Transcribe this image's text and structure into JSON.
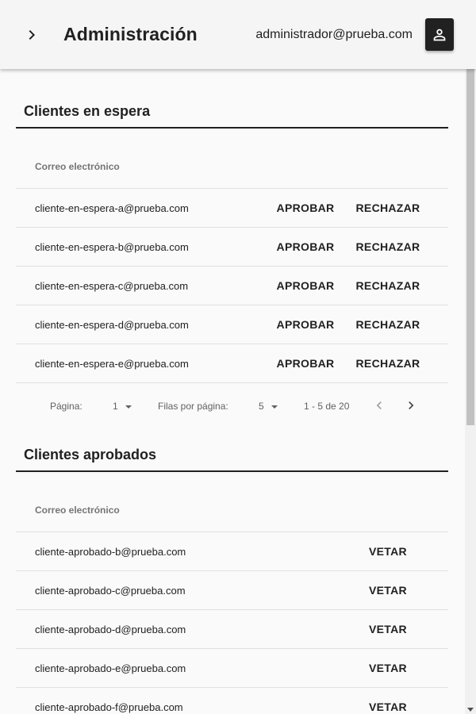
{
  "header": {
    "title": "Administración",
    "user_email": "administrador@prueba.com",
    "menu_icon": "chevron-right-icon",
    "user_icon": "person-icon"
  },
  "pending": {
    "title": "Clientes en espera",
    "column_header": "Correo electrónico",
    "approve_label": "APROBAR",
    "reject_label": "RECHAZAR",
    "rows": [
      {
        "email": "cliente-en-espera-a@prueba.com"
      },
      {
        "email": "cliente-en-espera-b@prueba.com"
      },
      {
        "email": "cliente-en-espera-c@prueba.com"
      },
      {
        "email": "cliente-en-espera-d@prueba.com"
      },
      {
        "email": "cliente-en-espera-e@prueba.com"
      }
    ],
    "paginator": {
      "page_label": "Página:",
      "page_value": "1",
      "rows_label": "Filas por página:",
      "rows_value": "5",
      "range": "1 - 5 de 20"
    }
  },
  "approved": {
    "title": "Clientes aprobados",
    "column_header": "Correo electrónico",
    "veto_label": "VETAR",
    "rows": [
      {
        "email": "cliente-aprobado-b@prueba.com"
      },
      {
        "email": "cliente-aprobado-c@prueba.com"
      },
      {
        "email": "cliente-aprobado-d@prueba.com"
      },
      {
        "email": "cliente-aprobado-e@prueba.com"
      },
      {
        "email": "cliente-aprobado-f@prueba.com"
      }
    ]
  },
  "colors": {
    "toolbar_bg": "#f5f5f5",
    "page_bg": "#fafafa",
    "text": "#212121",
    "muted": "#757575",
    "divider": "#e0e0e0"
  }
}
